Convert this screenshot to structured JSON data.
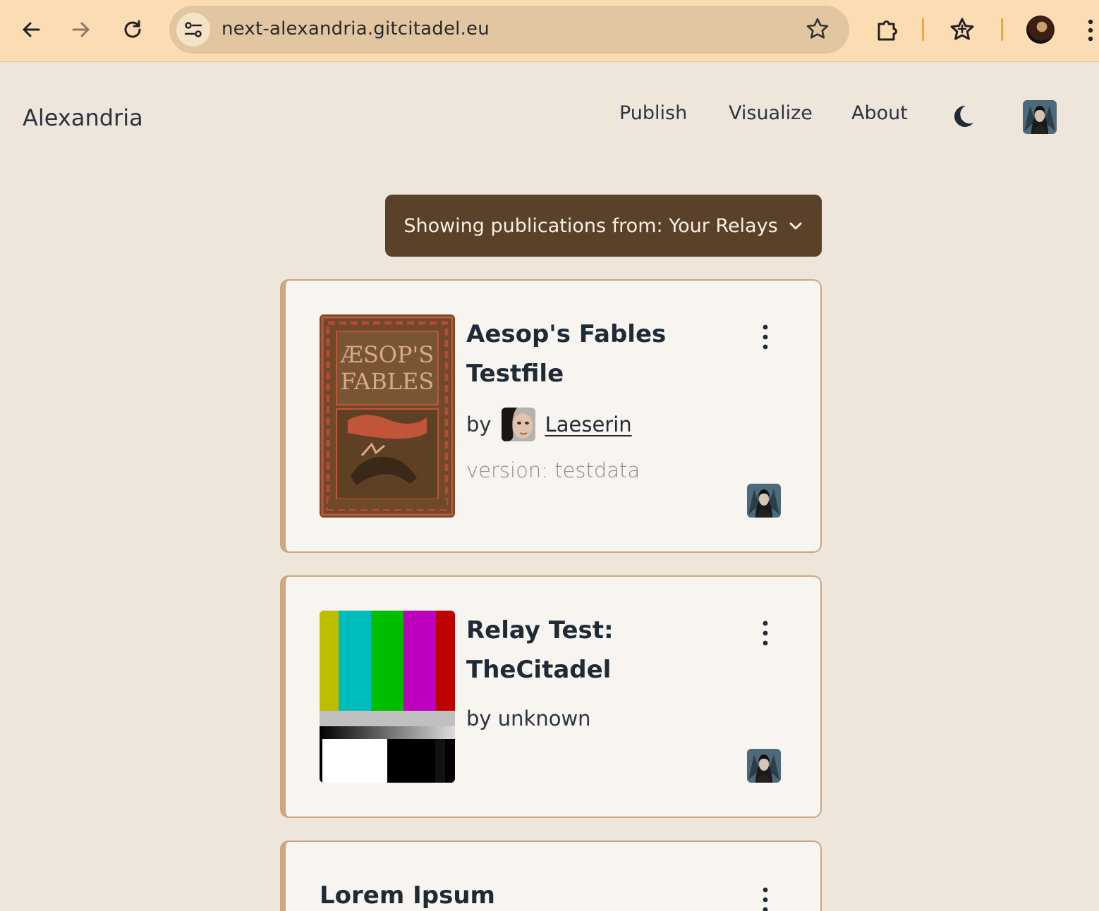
{
  "browser": {
    "url": "next-alexandria.gitcitadel.eu"
  },
  "app": {
    "brand": "Alexandria",
    "nav": {
      "publish": "Publish",
      "visualize": "Visualize",
      "about": "About"
    }
  },
  "relay_filter": {
    "label": "Showing publications from: Your Relays"
  },
  "publications": [
    {
      "title_line1": "Aesop's Fables",
      "title_line2": "Testfile",
      "by": "by",
      "author": "Laeserin",
      "version": "version: testdata",
      "cover_text_1": "ÆSOP'S",
      "cover_text_2": "FABLES"
    },
    {
      "title_line1": "Relay Test:",
      "title_line2": "TheCitadel",
      "by_unknown": "by unknown"
    },
    {
      "title_line1": "Lorem Ipsum"
    }
  ],
  "colors": {
    "page_bg": "#efe6db",
    "chrome_bg": "#fbdcb3",
    "relay_button": "#5a4129",
    "card_border": "#c9a882",
    "card_bg": "#f8f4ef"
  }
}
